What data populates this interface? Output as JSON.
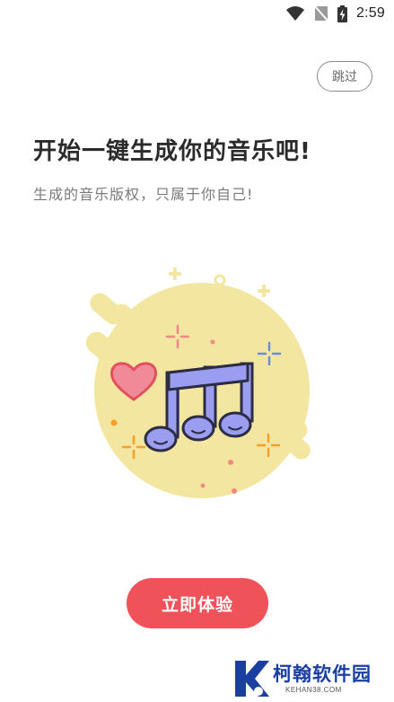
{
  "status_bar": {
    "time": "2:59",
    "icons": [
      "wifi-icon",
      "no-signal-icon",
      "battery-charging-icon"
    ]
  },
  "skip_button": {
    "label": "跳过"
  },
  "content": {
    "title": "开始一键生成你的音乐吧!",
    "subtitle": "生成的音乐版权，只属于你自己!"
  },
  "illustration": {
    "icon": "music-notes-icon",
    "decorations": [
      "heart-icon",
      "sparkle-icon",
      "plus-icon"
    ],
    "colors": {
      "blob": "#f3e6a0",
      "notes_fill": "#9b9ef0",
      "outline": "#2c2c44",
      "heart": "#f08a98",
      "heart_outline": "#e0505e",
      "sparkle_pink": "#f08a84",
      "sparkle_blue": "#6c8ce0",
      "sparkle_orange": "#f5a02c"
    }
  },
  "start_button": {
    "label": "立即体验",
    "color": "#f0525a"
  },
  "watermark": {
    "name": "柯翰软件园",
    "domain": "KEHAN38.COM",
    "color": "#1a3fa0"
  }
}
